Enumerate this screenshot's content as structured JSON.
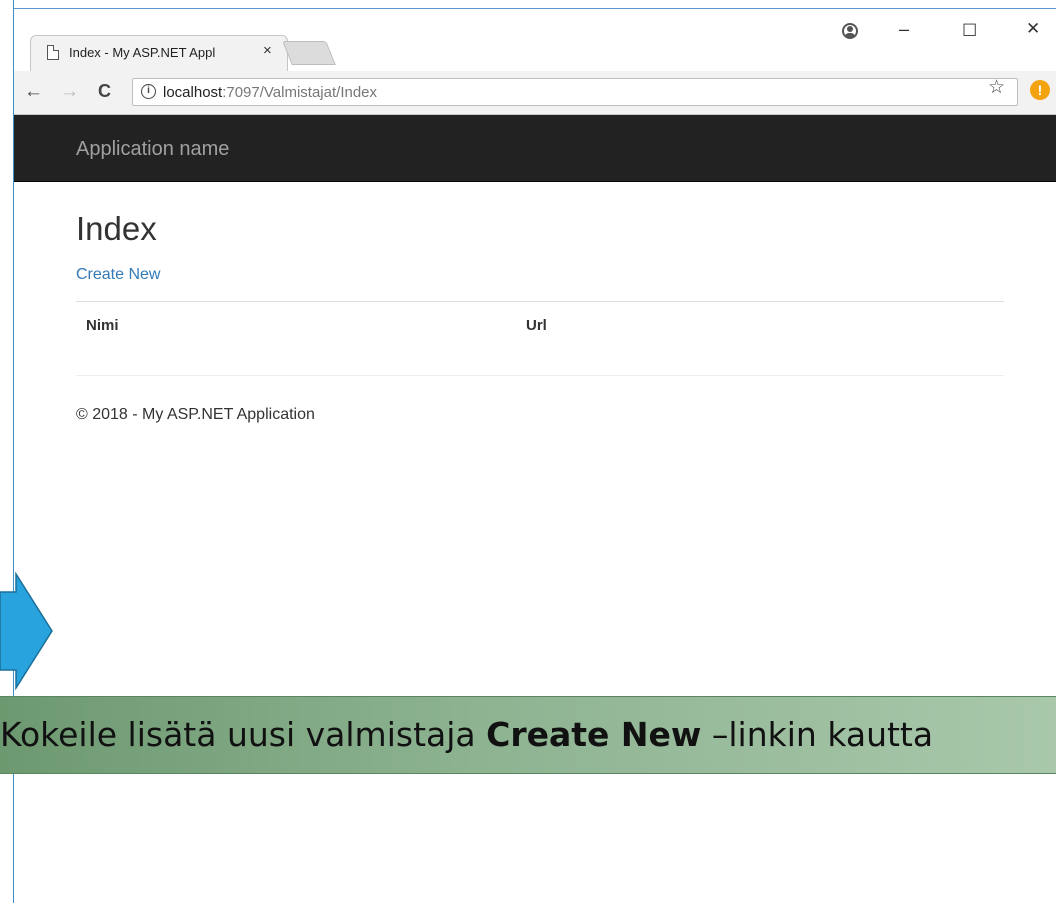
{
  "browser": {
    "tab_title": "Index - My ASP.NET Appl",
    "tab_close": "×",
    "window_controls": {
      "minimize": "–",
      "maximize": "☐",
      "close": "✕"
    },
    "nav": {
      "back": "←",
      "forward": "→",
      "reload": "C"
    },
    "url_host": "localhost",
    "url_path": ":7097/Valmistajat/Index",
    "info_glyph": "i",
    "star_glyph": "☆",
    "alert_glyph": "!"
  },
  "navbar": {
    "brand": "Application name"
  },
  "page": {
    "title": "Index",
    "create_link": "Create New",
    "columns": [
      "Nimi",
      "Url"
    ],
    "footer": "© 2018 - My ASP.NET Application"
  },
  "caption": {
    "before": "Kokeile lisätä uusi valmistaja ",
    "bold": "Create New",
    "after": " –linkin kautta"
  },
  "colors": {
    "navbar_bg": "#222222",
    "link": "#337ab7",
    "arrow_fill": "#29a3de",
    "caption_bg": "#8db391"
  }
}
